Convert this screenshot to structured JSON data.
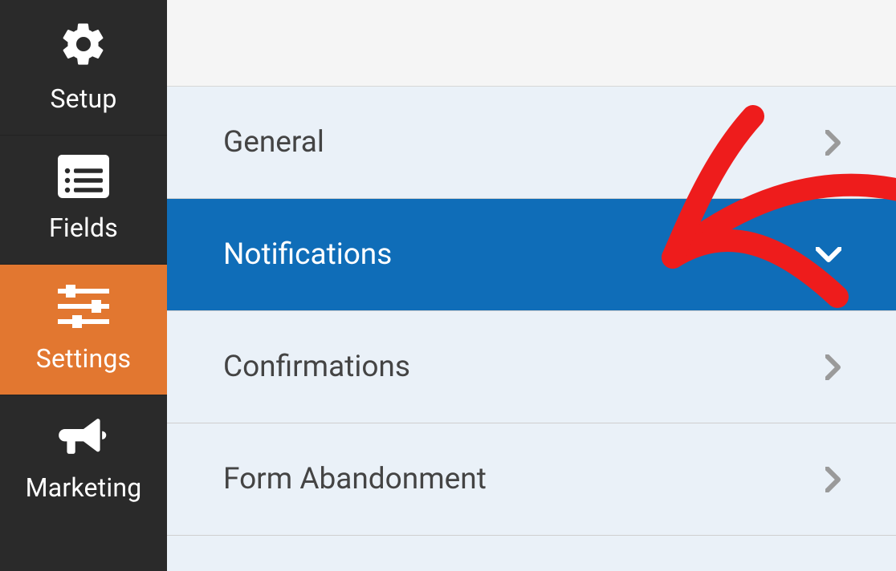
{
  "sidebar": {
    "items": [
      {
        "label": "Setup"
      },
      {
        "label": "Fields"
      },
      {
        "label": "Settings"
      },
      {
        "label": "Marketing"
      }
    ]
  },
  "settings_menu": {
    "items": [
      {
        "label": "General"
      },
      {
        "label": "Notifications"
      },
      {
        "label": "Confirmations"
      },
      {
        "label": "Form Abandonment"
      }
    ]
  },
  "colors": {
    "sidebar_bg": "#2a2a2a",
    "sidebar_active": "#e27730",
    "menu_active": "#0f6db8",
    "menu_bg": "#eaf1f8"
  }
}
